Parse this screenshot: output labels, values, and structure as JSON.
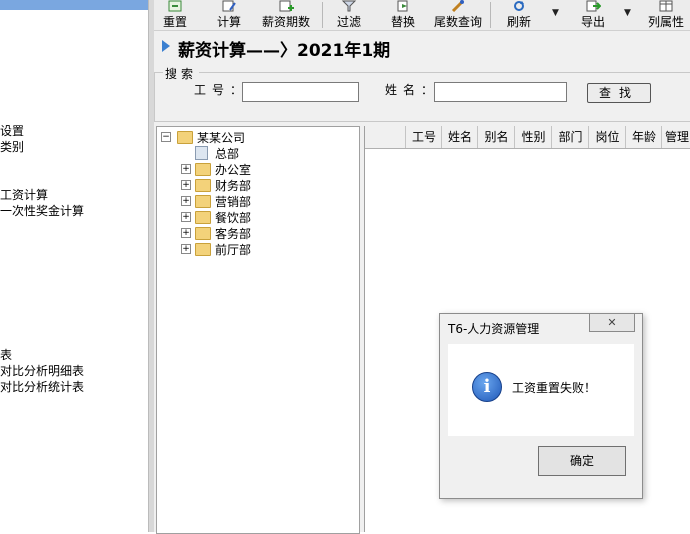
{
  "left_nav": {
    "items": [
      "设置",
      "类别",
      "工资计算",
      "一次性奖金计算",
      "表",
      "对比分析明细表",
      "对比分析统计表"
    ]
  },
  "toolbar": {
    "buttons": [
      "重置",
      "计算",
      "薪资期数",
      "过滤",
      "替换",
      "尾数查询",
      "刷新",
      "导出",
      "列属性"
    ]
  },
  "page": {
    "title": "薪资计算——〉2021年1期"
  },
  "search": {
    "legend": "搜索",
    "emp_no_label": "工号：",
    "name_label": "姓名：",
    "find_button": "查找",
    "emp_no_value": "",
    "name_value": ""
  },
  "tree": {
    "root": "某某公司",
    "children": [
      "总部",
      "办公室",
      "财务部",
      "营销部",
      "餐饮部",
      "客务部",
      "前厅部"
    ]
  },
  "grid": {
    "columns": [
      "工号",
      "姓名",
      "别名",
      "性别",
      "部门",
      "岗位",
      "年龄",
      "管理"
    ]
  },
  "dialog": {
    "title": "T6-人力资源管理",
    "message": "工资重置失败！",
    "ok_button": "确定",
    "close_icon": "close-icon",
    "info_icon": "info-icon"
  },
  "colors": {
    "title_arrow": "#3a7fd0",
    "left_top_bar": "#7aa7e0",
    "folder": "#f3d27a"
  }
}
